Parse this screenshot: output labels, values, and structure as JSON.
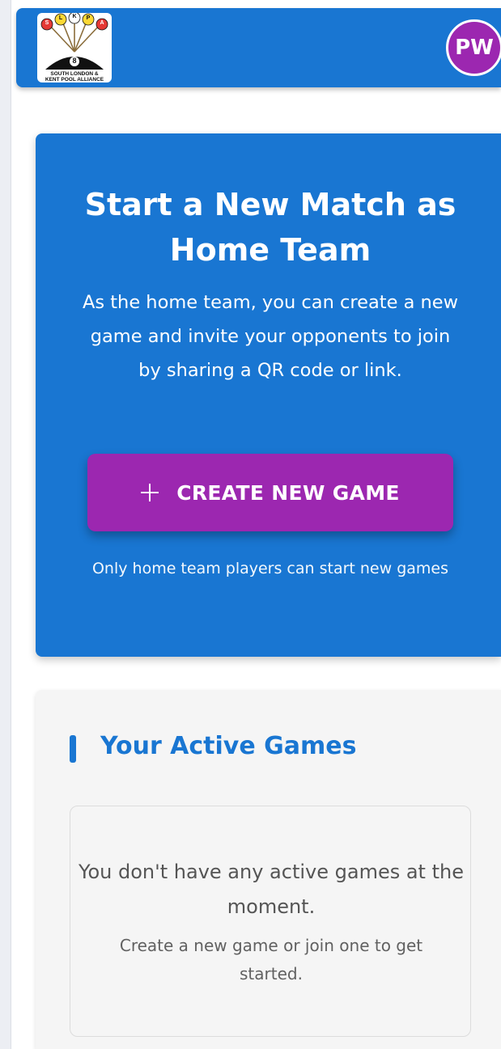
{
  "header": {
    "logo": {
      "letters": [
        "S",
        "L",
        "K",
        "P",
        "A"
      ],
      "ball_number": "8",
      "caption_line1": "SOUTH LONDON &",
      "caption_line2": "KENT POOL ALLIANCE"
    },
    "avatar_initials": "PW"
  },
  "hero": {
    "title": "Start a New Match as Home Team",
    "description": "As the home team, you can create a new game and invite your opponents to join by sharing a QR code or link.",
    "create_button_label": "CREATE NEW GAME",
    "note": "Only home team players can start new games"
  },
  "active_games": {
    "title": "Your Active Games",
    "empty_message": "You don't have any active games at the moment.",
    "empty_hint": "Create a new game or join one to get started."
  },
  "colors": {
    "primary": "#1976d2",
    "accent": "#9c27b0",
    "card_bg": "#f5f5f5"
  }
}
